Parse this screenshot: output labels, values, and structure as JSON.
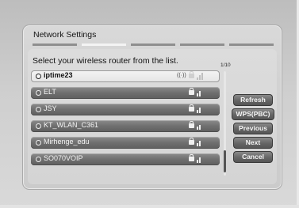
{
  "dialog": {
    "title": "Network Settings",
    "instruction": "Select your wireless router from the list.",
    "page_indicator": "1/10"
  },
  "networks": [
    {
      "ssid": "iptime23",
      "selected": true,
      "wps": true
    },
    {
      "ssid": "ELT",
      "selected": false
    },
    {
      "ssid": "JSY",
      "selected": false
    },
    {
      "ssid": "KT_WLAN_C361",
      "selected": false
    },
    {
      "ssid": "Mirhenge_edu",
      "selected": false
    },
    {
      "ssid": "SO070VOIP",
      "selected": false
    }
  ],
  "buttons": {
    "refresh": "Refresh",
    "wps": "WPS(PBC)",
    "previous": "Previous",
    "next": "Next",
    "cancel": "Cancel"
  },
  "progress": {
    "current_step": 2,
    "total_steps": 5
  },
  "icons": {
    "row_radio": "radio-dot-icon",
    "security": "lock-icon",
    "signal": "signal-strength-icon",
    "wps": "wps-icon"
  },
  "colors": {
    "row_bg": "#6f6f6f",
    "selected_row_bg": "#f0f0f0",
    "panel_bg": "#d4d4d4"
  }
}
